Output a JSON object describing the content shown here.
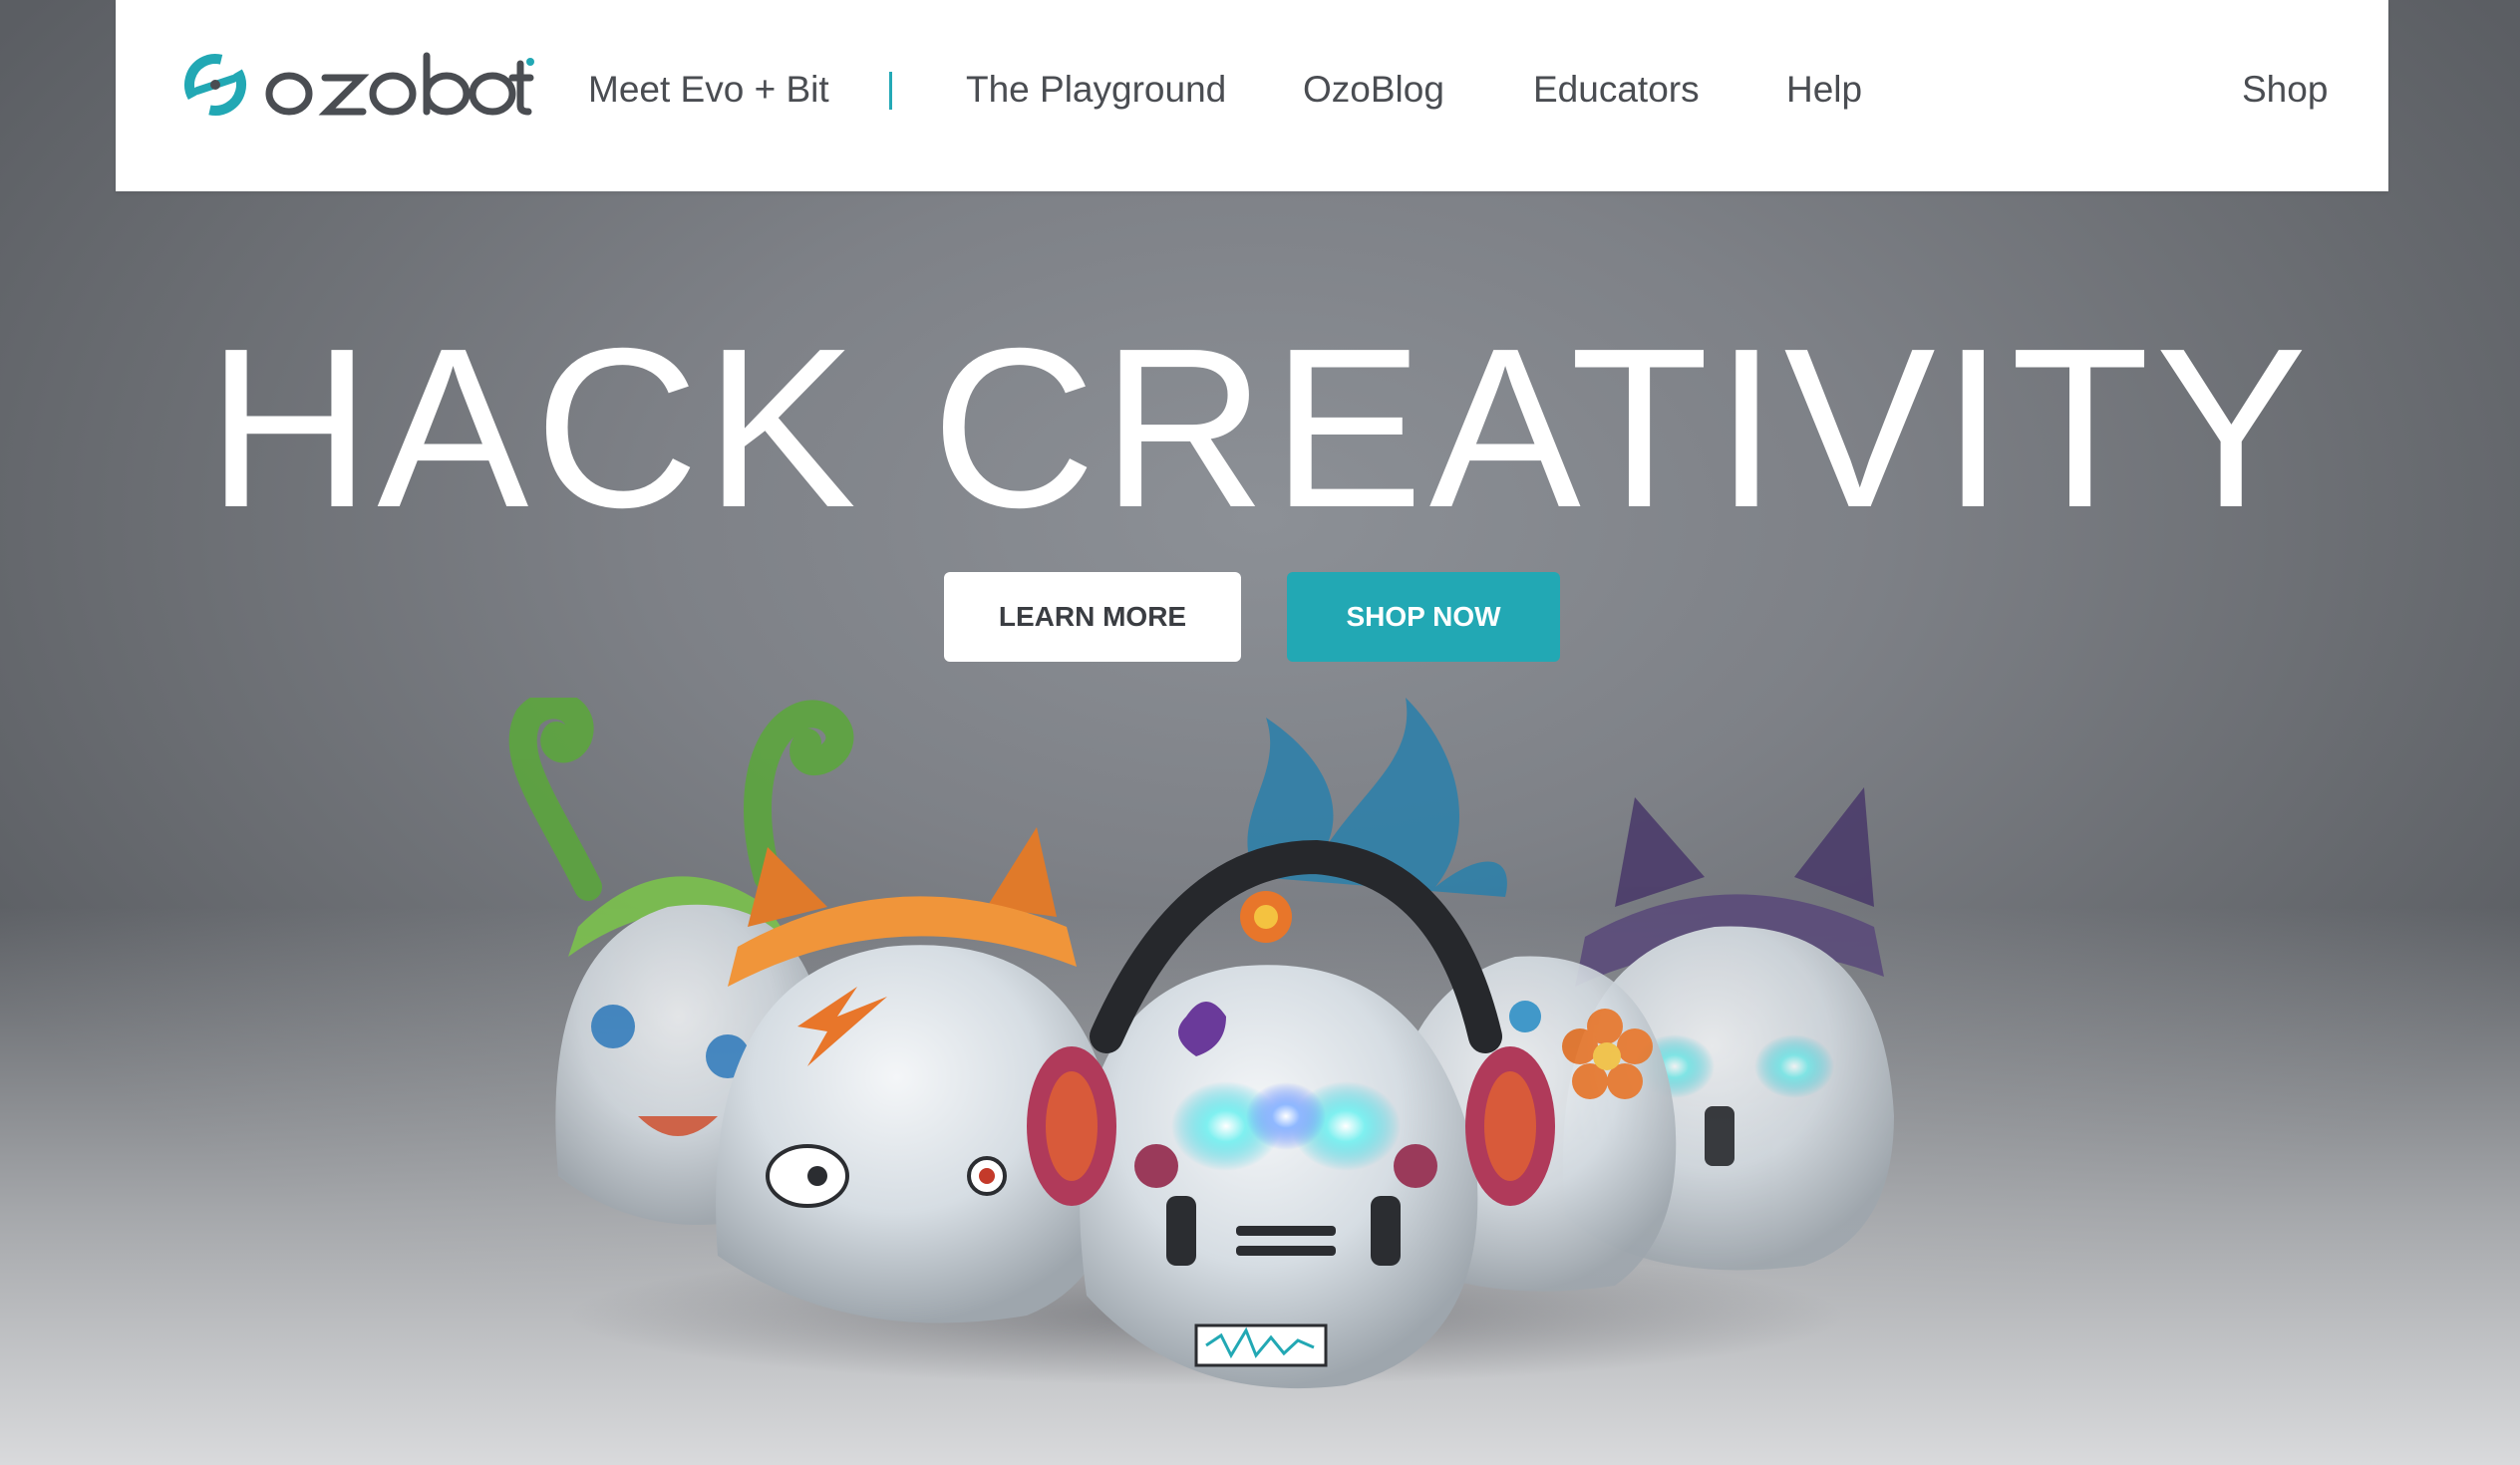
{
  "brand": {
    "name": "ozobot",
    "accent_color": "#22a8b4",
    "text_color": "#4a4d52"
  },
  "nav": {
    "items": [
      {
        "label": "Meet Evo + Bit"
      },
      {
        "label": "The Playground"
      },
      {
        "label": "OzoBlog"
      },
      {
        "label": "Educators"
      },
      {
        "label": "Help"
      }
    ],
    "shop_label": "Shop"
  },
  "hero": {
    "title": "HACK CREATIVITY",
    "learn_more_label": "LEARN MORE",
    "shop_now_label": "SHOP NOW",
    "image_subject": "ozobot-robots-group"
  }
}
